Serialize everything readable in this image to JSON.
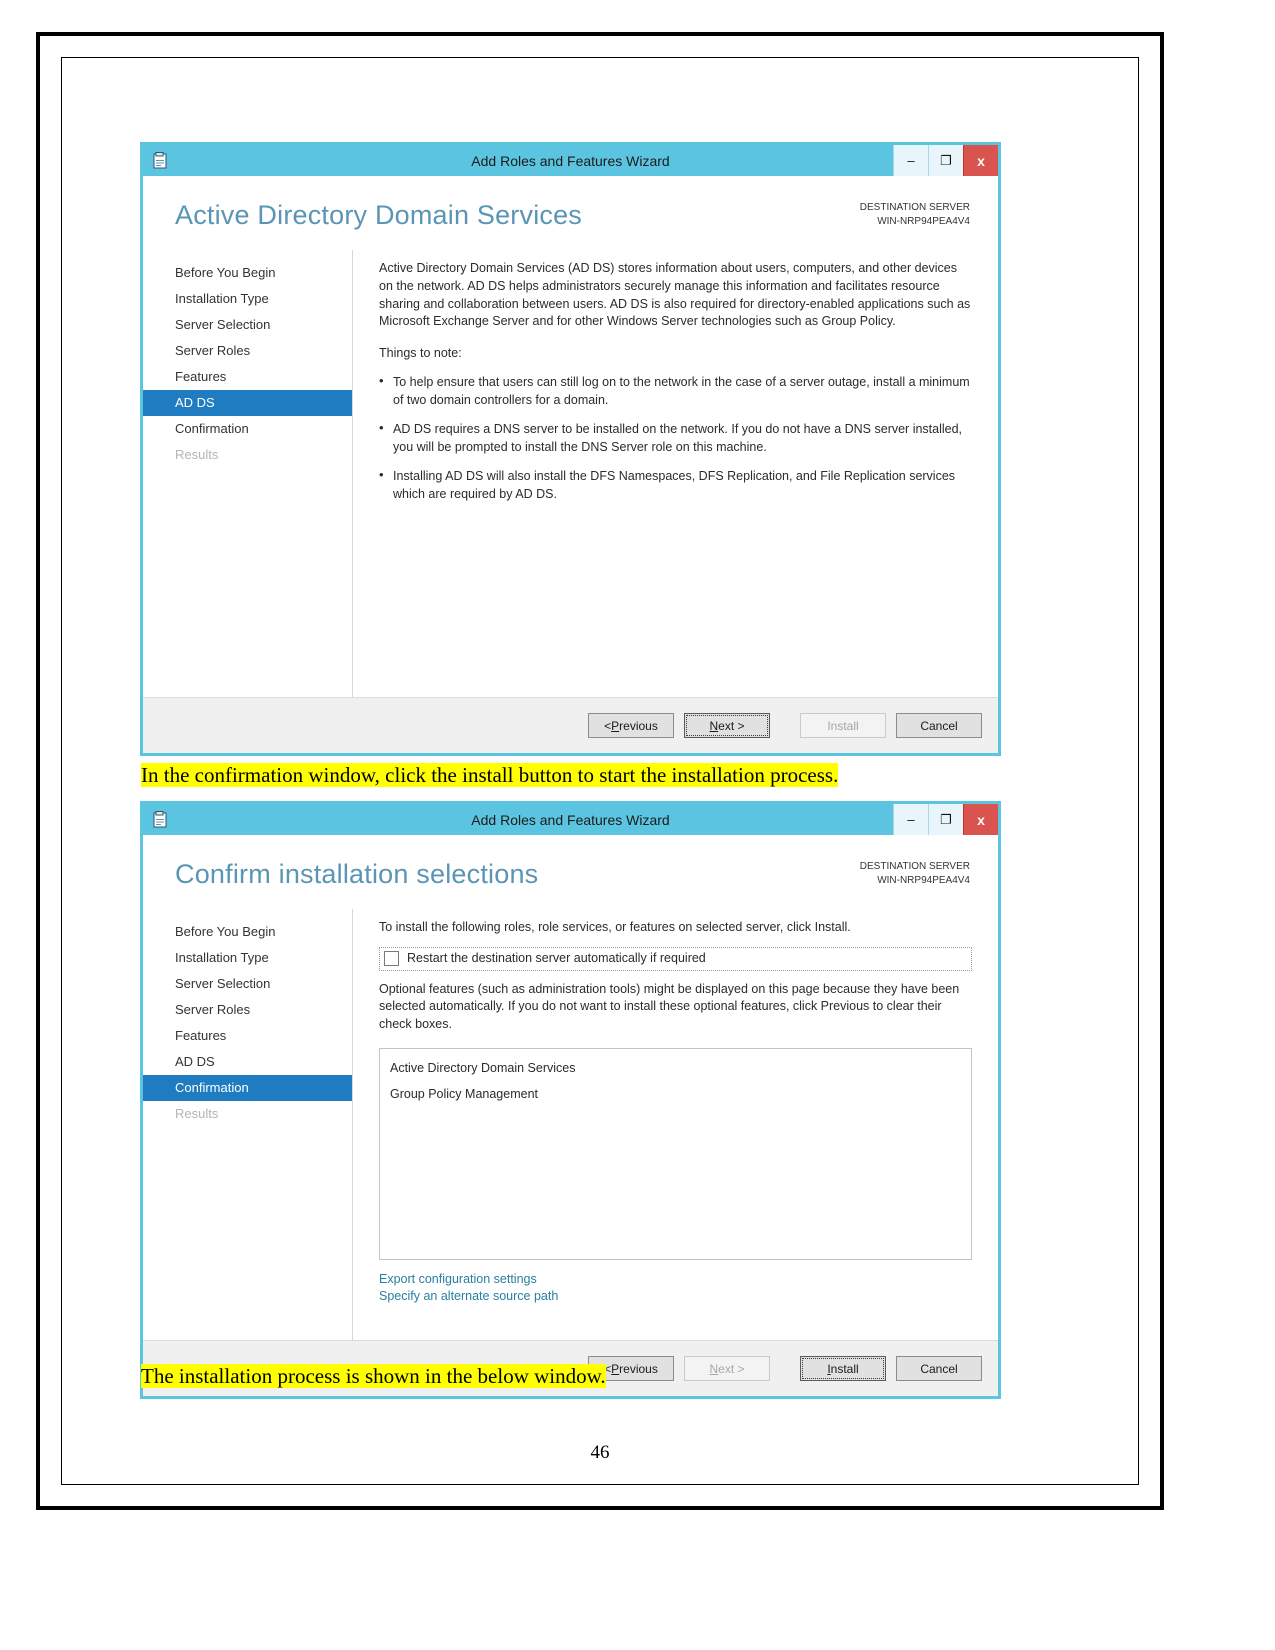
{
  "document": {
    "page_number": "46",
    "caption_1": "In the confirmation window, click the install button to start the installation process.",
    "caption_2": "The installation process is shown in the below window."
  },
  "window1": {
    "titlebar": {
      "title": "Add Roles and Features Wizard",
      "icon": "wizard-icon",
      "minimize": "–",
      "maximize": "❐",
      "close": "x"
    },
    "page_title": "Active Directory Domain Services",
    "destination_server_label": "DESTINATION SERVER",
    "destination_server_name": "WIN-NRP94PEA4V4",
    "nav_items": [
      {
        "label": "Before You Begin",
        "state": "normal"
      },
      {
        "label": "Installation Type",
        "state": "normal"
      },
      {
        "label": "Server Selection",
        "state": "normal"
      },
      {
        "label": "Server Roles",
        "state": "normal"
      },
      {
        "label": "Features",
        "state": "normal"
      },
      {
        "label": "AD DS",
        "state": "active"
      },
      {
        "label": "Confirmation",
        "state": "normal"
      },
      {
        "label": "Results",
        "state": "disabled"
      }
    ],
    "intro_paragraph": "Active Directory Domain Services (AD DS) stores information about users, computers, and other devices on the network.  AD DS helps administrators securely manage this information and facilitates resource sharing and collaboration between users.  AD DS is also required for directory-enabled applications such as Microsoft Exchange Server and for other Windows Server technologies such as Group Policy.",
    "things_to_note_label": "Things to note:",
    "notes": [
      "To help ensure that users can still log on to the network in the case of a server outage, install a minimum of two domain controllers for a domain.",
      "AD DS requires a DNS server to be installed on the network.  If you do not have a DNS server installed, you will be prompted to install the DNS Server role on this machine.",
      "Installing AD DS will also install the DFS Namespaces, DFS Replication, and File Replication services which are required by AD DS."
    ],
    "buttons": {
      "previous": "< Previous",
      "previous_prefix": "< ",
      "previous_accel": "P",
      "previous_rest": "revious",
      "next_prefix": "",
      "next_accel": "N",
      "next_rest": "ext >",
      "install": "Install",
      "cancel": "Cancel"
    }
  },
  "window2": {
    "titlebar": {
      "title": "Add Roles and Features Wizard",
      "icon": "wizard-icon",
      "minimize": "–",
      "maximize": "❐",
      "close": "x"
    },
    "page_title": "Confirm installation selections",
    "destination_server_label": "DESTINATION SERVER",
    "destination_server_name": "WIN-NRP94PEA4V4",
    "nav_items": [
      {
        "label": "Before You Begin",
        "state": "normal"
      },
      {
        "label": "Installation Type",
        "state": "normal"
      },
      {
        "label": "Server Selection",
        "state": "normal"
      },
      {
        "label": "Server Roles",
        "state": "normal"
      },
      {
        "label": "Features",
        "state": "normal"
      },
      {
        "label": "AD DS",
        "state": "normal"
      },
      {
        "label": "Confirmation",
        "state": "active"
      },
      {
        "label": "Results",
        "state": "disabled"
      }
    ],
    "instruction": "To install the following roles, role services, or features on selected server, click Install.",
    "restart_checkbox_label": "Restart the destination server automatically if required",
    "restart_checkbox_checked": false,
    "optional_features_paragraph": "Optional features (such as administration tools) might be displayed on this page because they have been selected automatically. If you do not want to install these optional features, click Previous to clear their check boxes.",
    "selected_items": [
      "Active Directory Domain Services",
      "Group Policy Management"
    ],
    "links": [
      "Export configuration settings",
      "Specify an alternate source path"
    ],
    "buttons": {
      "previous_prefix": "< ",
      "previous_accel": "P",
      "previous_rest": "revious",
      "next_prefix": "",
      "next_accel": "N",
      "next_rest": "ext >",
      "install_accel": "I",
      "install_rest": "nstall",
      "cancel": "Cancel"
    }
  },
  "colors": {
    "titlebar": "#5bc4e0",
    "accent_title": "#5b95b5",
    "nav_active": "#1f7cc1",
    "close_button": "#d9534f",
    "link": "#2a7ea1",
    "highlight": "#ffff00"
  }
}
